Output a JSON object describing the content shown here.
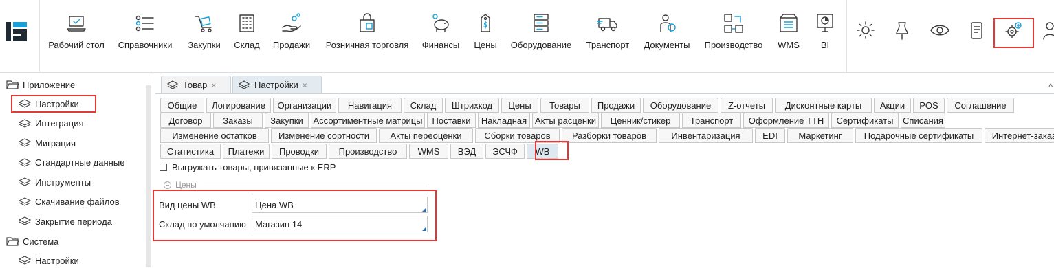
{
  "colors": {
    "accent": "#1f7fbf",
    "highlight": "#e53935",
    "icon_blue": "#1aa0d8"
  },
  "toolbar": {
    "items": [
      {
        "label": "Рабочий стол",
        "icon": "desktop-icon"
      },
      {
        "label": "Справочники",
        "icon": "list-icon"
      },
      {
        "label": "Закупки",
        "icon": "cart-icon"
      },
      {
        "label": "Склад",
        "icon": "warehouse-icon"
      },
      {
        "label": "Продажи",
        "icon": "hand-coins-icon"
      },
      {
        "label": "Розничная торговля",
        "icon": "shopping-bag-icon"
      },
      {
        "label": "Финансы",
        "icon": "piggy-bank-icon"
      },
      {
        "label": "Цены",
        "icon": "price-tag-icon"
      },
      {
        "label": "Оборудование",
        "icon": "server-icon"
      },
      {
        "label": "Транспорт",
        "icon": "truck-icon"
      },
      {
        "label": "Документы",
        "icon": "user-globe-icon"
      },
      {
        "label": "Производство",
        "icon": "workflow-icon"
      },
      {
        "label": "WMS",
        "icon": "box-icon"
      },
      {
        "label": "BI",
        "icon": "presentation-icon"
      }
    ],
    "right_icons": [
      "brightness-icon",
      "pin-icon",
      "eye-icon",
      "mobile-icon",
      "settings-icon",
      "user-icon"
    ]
  },
  "sidebar": {
    "groups": [
      {
        "label": "Приложение",
        "items": [
          "Настройки",
          "Интеграция",
          "Миграция",
          "Стандартные данные",
          "Инструменты",
          "Скачивание файлов",
          "Закрытие периода"
        ]
      },
      {
        "label": "Система",
        "items": [
          "Настройки"
        ]
      }
    ]
  },
  "doc_tabs": [
    {
      "label": "Товар",
      "close": "×"
    },
    {
      "label": "Настройки",
      "close": "×"
    }
  ],
  "settings_tabs": {
    "row1": [
      "Общие",
      "Логирование",
      "Организации",
      "Навигация",
      "Склад",
      "Штрихкод",
      "Цены",
      "Товары",
      "Продажи",
      "Оборудование",
      "Z-отчеты",
      "Дисконтные карты",
      "Акции",
      "POS",
      "Соглашение"
    ],
    "row2": [
      "Договор",
      "Заказы",
      "Закупки",
      "Ассортиментные матрицы",
      "Поставки",
      "Накладная",
      "Акты расценки",
      "Ценник/стикер",
      "Транспорт",
      "Оформление ТТН",
      "Сертификаты",
      "Списания"
    ],
    "row3": [
      "Изменение остатков",
      "Изменение сортности",
      "Акты переоценки",
      "Сборки товаров",
      "Разборки товаров",
      "Инвентаризация",
      "EDI",
      "Маркетинг",
      "Подарочные сертификаты",
      "Интернет-заказы"
    ],
    "row4": [
      "Статистика",
      "Платежи",
      "Проводки",
      "Производство",
      "WMS",
      "ВЭД",
      "ЭСЧФ",
      "WB"
    ]
  },
  "form": {
    "checkbox_label": "Выгружать товары, привязанные к ERP",
    "group_title": "Цены",
    "price_type_label": "Вид цены WB",
    "price_type_value": "Цена WB",
    "default_warehouse_label": "Склад по умолчанию",
    "default_warehouse_value": "Магазин 14"
  }
}
